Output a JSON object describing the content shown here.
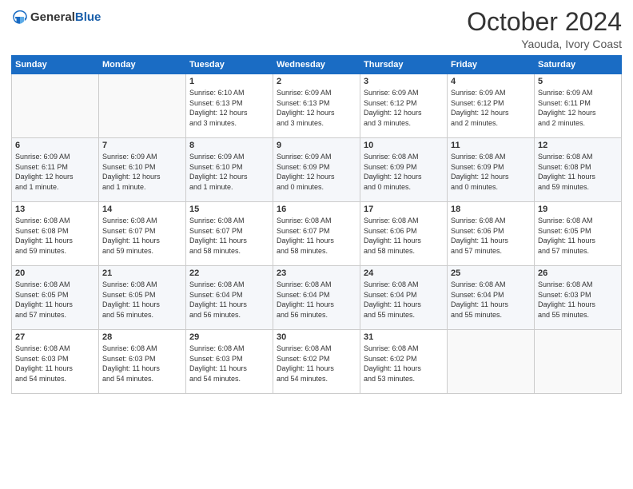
{
  "logo": {
    "text_general": "General",
    "text_blue": "Blue"
  },
  "header": {
    "month_title": "October 2024",
    "location": "Yaouda, Ivory Coast"
  },
  "days_of_week": [
    "Sunday",
    "Monday",
    "Tuesday",
    "Wednesday",
    "Thursday",
    "Friday",
    "Saturday"
  ],
  "weeks": [
    [
      {
        "day": "",
        "info": ""
      },
      {
        "day": "",
        "info": ""
      },
      {
        "day": "1",
        "info": "Sunrise: 6:10 AM\nSunset: 6:13 PM\nDaylight: 12 hours\nand 3 minutes."
      },
      {
        "day": "2",
        "info": "Sunrise: 6:09 AM\nSunset: 6:13 PM\nDaylight: 12 hours\nand 3 minutes."
      },
      {
        "day": "3",
        "info": "Sunrise: 6:09 AM\nSunset: 6:12 PM\nDaylight: 12 hours\nand 3 minutes."
      },
      {
        "day": "4",
        "info": "Sunrise: 6:09 AM\nSunset: 6:12 PM\nDaylight: 12 hours\nand 2 minutes."
      },
      {
        "day": "5",
        "info": "Sunrise: 6:09 AM\nSunset: 6:11 PM\nDaylight: 12 hours\nand 2 minutes."
      }
    ],
    [
      {
        "day": "6",
        "info": "Sunrise: 6:09 AM\nSunset: 6:11 PM\nDaylight: 12 hours\nand 1 minute."
      },
      {
        "day": "7",
        "info": "Sunrise: 6:09 AM\nSunset: 6:10 PM\nDaylight: 12 hours\nand 1 minute."
      },
      {
        "day": "8",
        "info": "Sunrise: 6:09 AM\nSunset: 6:10 PM\nDaylight: 12 hours\nand 1 minute."
      },
      {
        "day": "9",
        "info": "Sunrise: 6:09 AM\nSunset: 6:09 PM\nDaylight: 12 hours\nand 0 minutes."
      },
      {
        "day": "10",
        "info": "Sunrise: 6:08 AM\nSunset: 6:09 PM\nDaylight: 12 hours\nand 0 minutes."
      },
      {
        "day": "11",
        "info": "Sunrise: 6:08 AM\nSunset: 6:09 PM\nDaylight: 12 hours\nand 0 minutes."
      },
      {
        "day": "12",
        "info": "Sunrise: 6:08 AM\nSunset: 6:08 PM\nDaylight: 11 hours\nand 59 minutes."
      }
    ],
    [
      {
        "day": "13",
        "info": "Sunrise: 6:08 AM\nSunset: 6:08 PM\nDaylight: 11 hours\nand 59 minutes."
      },
      {
        "day": "14",
        "info": "Sunrise: 6:08 AM\nSunset: 6:07 PM\nDaylight: 11 hours\nand 59 minutes."
      },
      {
        "day": "15",
        "info": "Sunrise: 6:08 AM\nSunset: 6:07 PM\nDaylight: 11 hours\nand 58 minutes."
      },
      {
        "day": "16",
        "info": "Sunrise: 6:08 AM\nSunset: 6:07 PM\nDaylight: 11 hours\nand 58 minutes."
      },
      {
        "day": "17",
        "info": "Sunrise: 6:08 AM\nSunset: 6:06 PM\nDaylight: 11 hours\nand 58 minutes."
      },
      {
        "day": "18",
        "info": "Sunrise: 6:08 AM\nSunset: 6:06 PM\nDaylight: 11 hours\nand 57 minutes."
      },
      {
        "day": "19",
        "info": "Sunrise: 6:08 AM\nSunset: 6:05 PM\nDaylight: 11 hours\nand 57 minutes."
      }
    ],
    [
      {
        "day": "20",
        "info": "Sunrise: 6:08 AM\nSunset: 6:05 PM\nDaylight: 11 hours\nand 57 minutes."
      },
      {
        "day": "21",
        "info": "Sunrise: 6:08 AM\nSunset: 6:05 PM\nDaylight: 11 hours\nand 56 minutes."
      },
      {
        "day": "22",
        "info": "Sunrise: 6:08 AM\nSunset: 6:04 PM\nDaylight: 11 hours\nand 56 minutes."
      },
      {
        "day": "23",
        "info": "Sunrise: 6:08 AM\nSunset: 6:04 PM\nDaylight: 11 hours\nand 56 minutes."
      },
      {
        "day": "24",
        "info": "Sunrise: 6:08 AM\nSunset: 6:04 PM\nDaylight: 11 hours\nand 55 minutes."
      },
      {
        "day": "25",
        "info": "Sunrise: 6:08 AM\nSunset: 6:04 PM\nDaylight: 11 hours\nand 55 minutes."
      },
      {
        "day": "26",
        "info": "Sunrise: 6:08 AM\nSunset: 6:03 PM\nDaylight: 11 hours\nand 55 minutes."
      }
    ],
    [
      {
        "day": "27",
        "info": "Sunrise: 6:08 AM\nSunset: 6:03 PM\nDaylight: 11 hours\nand 54 minutes."
      },
      {
        "day": "28",
        "info": "Sunrise: 6:08 AM\nSunset: 6:03 PM\nDaylight: 11 hours\nand 54 minutes."
      },
      {
        "day": "29",
        "info": "Sunrise: 6:08 AM\nSunset: 6:03 PM\nDaylight: 11 hours\nand 54 minutes."
      },
      {
        "day": "30",
        "info": "Sunrise: 6:08 AM\nSunset: 6:02 PM\nDaylight: 11 hours\nand 54 minutes."
      },
      {
        "day": "31",
        "info": "Sunrise: 6:08 AM\nSunset: 6:02 PM\nDaylight: 11 hours\nand 53 minutes."
      },
      {
        "day": "",
        "info": ""
      },
      {
        "day": "",
        "info": ""
      }
    ]
  ]
}
